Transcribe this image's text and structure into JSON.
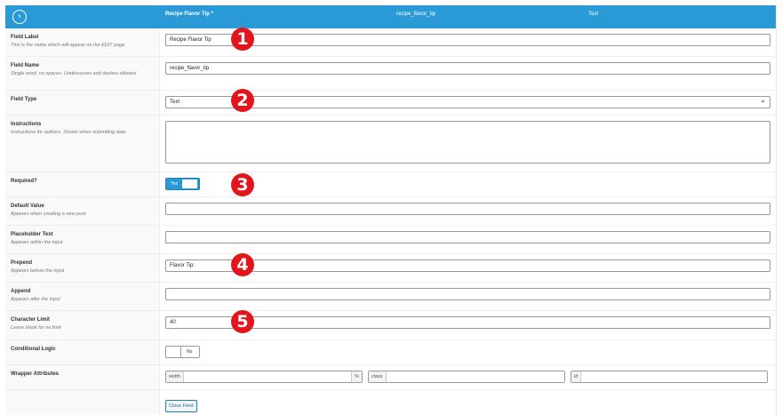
{
  "header": {
    "order": "5",
    "label": "Recipe Flavor Tip *",
    "name": "recipe_flavor_tip",
    "type": "Text"
  },
  "rows": {
    "field_label": {
      "label": "Field Label",
      "desc": "This is the name which will appear on the EDIT page",
      "value": "Recipe Flavor Tip"
    },
    "field_name": {
      "label": "Field Name",
      "desc": "Single word, no spaces. Underscores and dashes allowed",
      "value": "recipe_flavor_tip"
    },
    "field_type": {
      "label": "Field Type",
      "value": "Text"
    },
    "instructions": {
      "label": "Instructions",
      "desc": "Instructions for authors. Shown when submitting data",
      "value": ""
    },
    "required": {
      "label": "Required?",
      "toggle": "Yes"
    },
    "default_value": {
      "label": "Default Value",
      "desc": "Appears when creating a new post",
      "value": ""
    },
    "placeholder": {
      "label": "Placeholder Text",
      "desc": "Appears within the input",
      "value": ""
    },
    "prepend": {
      "label": "Prepend",
      "desc": "Appears before the input",
      "value": "Flavor Tip:"
    },
    "append": {
      "label": "Append",
      "desc": "Appears after the input",
      "value": ""
    },
    "char_limit": {
      "label": "Character Limit",
      "desc": "Leave blank for no limit",
      "value": "40"
    },
    "conditional": {
      "label": "Conditional Logic",
      "toggle": "No"
    },
    "wrapper": {
      "label": "Wrapper Attributes",
      "width": "width",
      "percent": "%",
      "class": "class",
      "id": "id"
    }
  },
  "close_button": "Close Field",
  "badges": [
    "1",
    "2",
    "3",
    "4",
    "5"
  ],
  "colors": {
    "header": "#2a9ad6",
    "badge": "#e3141b"
  }
}
